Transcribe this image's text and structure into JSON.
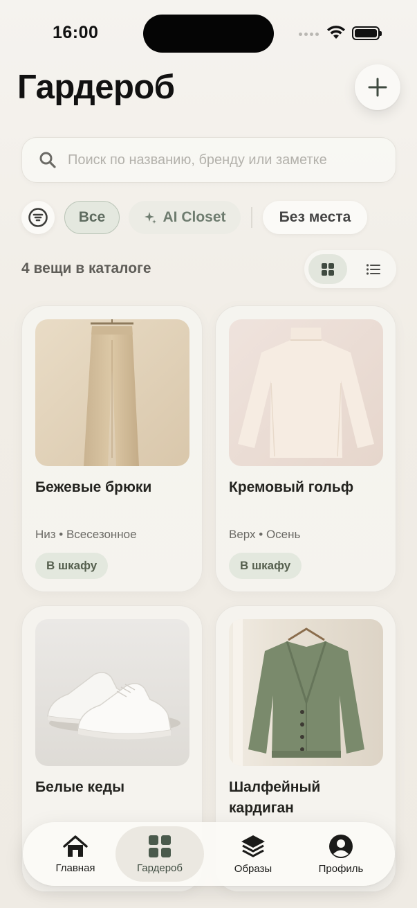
{
  "status_bar": {
    "time": "16:00"
  },
  "header": {
    "title": "Гардероб"
  },
  "search": {
    "placeholder": "Поиск по названию, бренду или заметке"
  },
  "filters": {
    "chips": [
      {
        "label": "Все",
        "selected": true
      },
      {
        "label": "AI Closet",
        "selected": false
      },
      {
        "label": "Без места",
        "selected": false
      }
    ]
  },
  "catalog": {
    "count_label": "4 вещи в каталоге",
    "view_mode": "grid",
    "items": [
      {
        "title": "Бежевые брюки",
        "meta": "Низ • Всесезонное",
        "badge": "В шкафу"
      },
      {
        "title": "Кремовый гольф",
        "meta": "Верх • Осень",
        "badge": "В шкафу"
      },
      {
        "title": "Белые кеды",
        "meta": "",
        "badge": ""
      },
      {
        "title": "Шалфейный кардиган",
        "meta": "",
        "badge": ""
      }
    ]
  },
  "tabbar": {
    "tabs": [
      {
        "label": "Главная",
        "icon": "home-icon",
        "active": false
      },
      {
        "label": "Гардероб",
        "icon": "grid-icon",
        "active": true
      },
      {
        "label": "Образы",
        "icon": "layers-icon",
        "active": false
      },
      {
        "label": "Профиль",
        "icon": "profile-icon",
        "active": false
      }
    ]
  },
  "colors": {
    "accent_green": "#5e6b5f",
    "chip_selected_bg": "#e4e8df",
    "tab_active_icon": "#4a5a4c"
  }
}
